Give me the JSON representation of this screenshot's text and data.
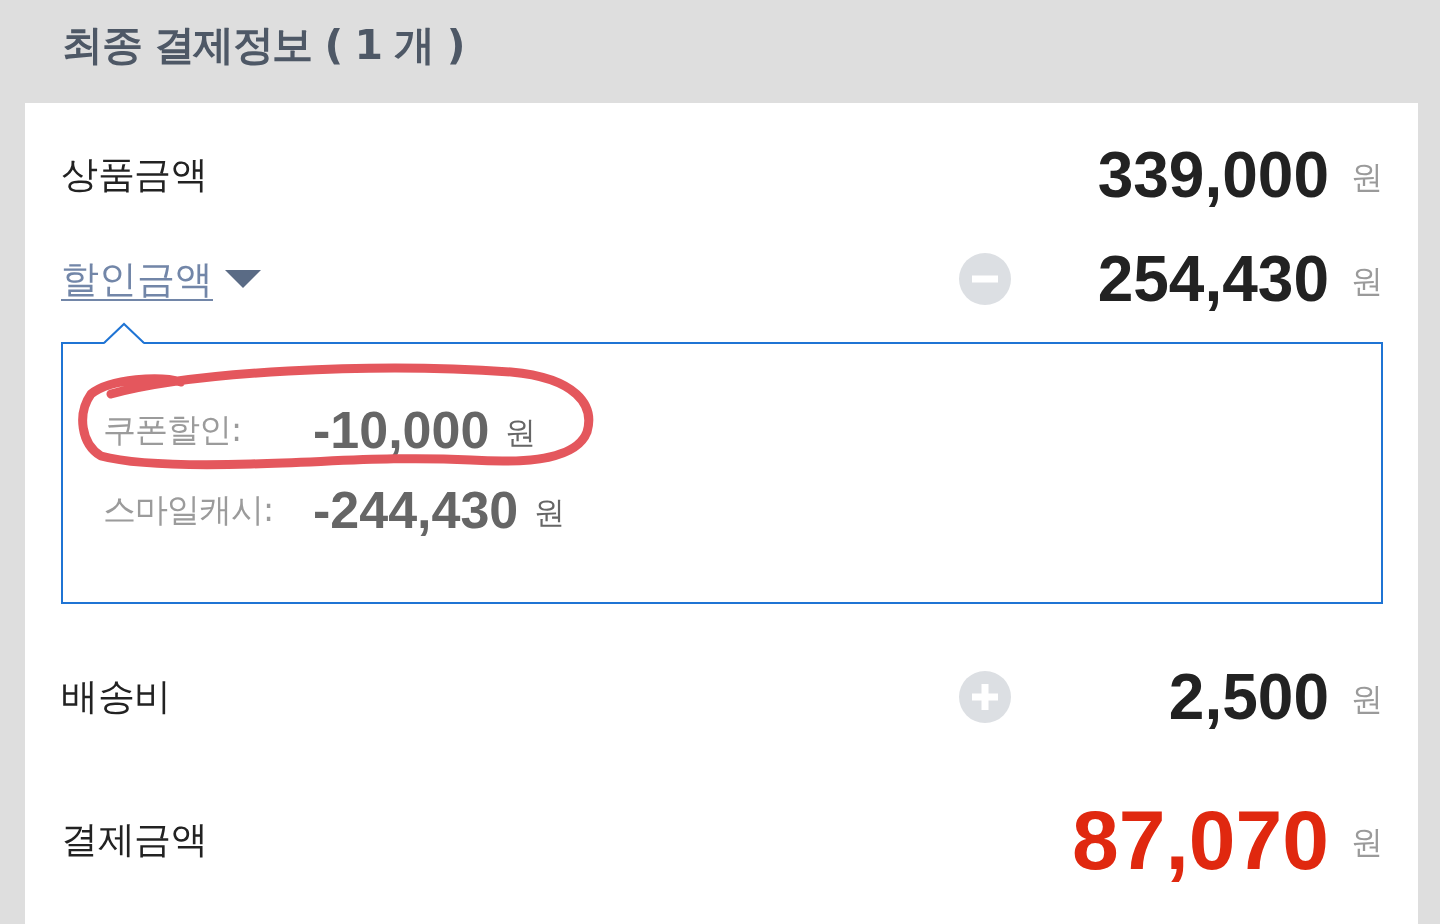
{
  "section": {
    "title": "최종 결제정보 ( 1 개 )"
  },
  "rows": [
    {
      "kind": "base",
      "label": "상품금액",
      "amount": "339,000",
      "unit": "원"
    },
    {
      "kind": "discount",
      "label": "할인금액",
      "expanded": true,
      "amount": "254,430",
      "unit": "원",
      "details": [
        {
          "label": "쿠폰할인:",
          "amount": "-10,000",
          "unit": "원",
          "circled": true
        },
        {
          "label": "스마일캐시:",
          "amount": "-244,430",
          "unit": "원",
          "circled": false
        }
      ]
    },
    {
      "kind": "surcharge",
      "label": "배송비",
      "amount": "2,500",
      "unit": "원"
    },
    {
      "kind": "total",
      "label": "결제금액",
      "amount": "87,070",
      "unit": "원"
    }
  ]
}
